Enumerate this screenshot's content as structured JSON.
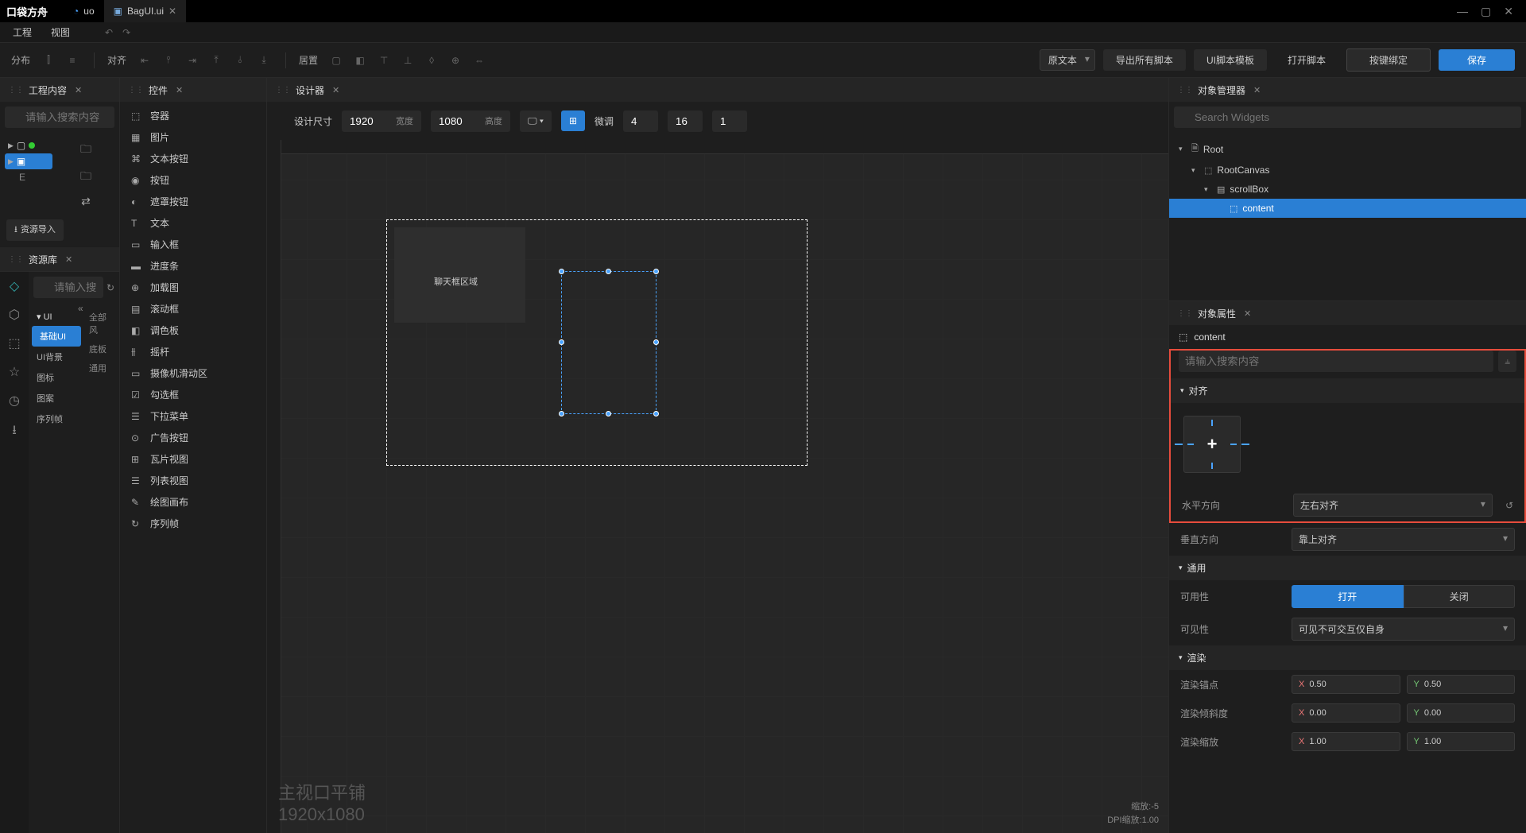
{
  "titlebar": {
    "logo": "口袋方舟",
    "tabs": [
      {
        "icon": "uo-icon",
        "label": "uo"
      },
      {
        "icon": "ui-icon",
        "label": "BagUI.ui"
      }
    ]
  },
  "menubar": {
    "items": [
      "工程",
      "视图"
    ]
  },
  "toolbar": {
    "distribute_label": "分布",
    "align_label": "对齐",
    "center_label": "居置",
    "source_dropdown": "原文本",
    "export_scripts": "导出所有脚本",
    "ui_script_template": "UI脚本模板",
    "open_script": "打开脚本",
    "key_binding": "按键绑定",
    "save": "保存"
  },
  "panels": {
    "project_content": "工程内容",
    "widgets": "控件",
    "designer": "设计器",
    "object_manager": "对象管理器",
    "object_props": "对象属性",
    "resource_lib": "资源库",
    "resource_import": "资源导入"
  },
  "search": {
    "project_placeholder": "请输入搜索内容",
    "resource_placeholder": "请输入搜",
    "widgets_placeholder": "Search Widgets",
    "props_placeholder": "请输入搜索内容"
  },
  "widgets": [
    {
      "icon": "⬚",
      "label": "容器"
    },
    {
      "icon": "▦",
      "label": "图片"
    },
    {
      "icon": "⌘",
      "label": "文本按钮"
    },
    {
      "icon": "◉",
      "label": "按钮"
    },
    {
      "icon": "◐",
      "label": "遮罩按钮"
    },
    {
      "icon": "T",
      "label": "文本"
    },
    {
      "icon": "▭",
      "label": "输入框"
    },
    {
      "icon": "▬",
      "label": "进度条"
    },
    {
      "icon": "⊕",
      "label": "加载图"
    },
    {
      "icon": "▤",
      "label": "滚动框"
    },
    {
      "icon": "◧",
      "label": "调色板"
    },
    {
      "icon": "⫵",
      "label": "摇杆"
    },
    {
      "icon": "▭",
      "label": "摄像机滑动区"
    },
    {
      "icon": "☑",
      "label": "勾选框"
    },
    {
      "icon": "☰",
      "label": "下拉菜单"
    },
    {
      "icon": "⊙",
      "label": "广告按钮"
    },
    {
      "icon": "⊞",
      "label": "瓦片视图"
    },
    {
      "icon": "☰",
      "label": "列表视图"
    },
    {
      "icon": "✎",
      "label": "绘图画布"
    },
    {
      "icon": "↻",
      "label": "序列帧"
    }
  ],
  "resource_categories": {
    "ui": "UI",
    "items": [
      "基础UI",
      "UI背景",
      "图标",
      "图案",
      "序列帧"
    ],
    "filters": [
      "全部风",
      "底板",
      "通用"
    ]
  },
  "design_toolbar": {
    "size_label": "设计尺寸",
    "width": "1920",
    "width_label": "宽度",
    "height": "1080",
    "height_label": "高度",
    "finetune_label": "微调",
    "val1": "4",
    "val2": "16",
    "val3": "1"
  },
  "canvas": {
    "chat_label": "聊天框区域",
    "viewport_label": "主视口平铺",
    "viewport_size": "1920x1080",
    "zoom": "缩放:-5",
    "dpi": "DPI缩放:1.00"
  },
  "object_tree": {
    "root": "Root",
    "canvas": "RootCanvas",
    "scrollbox": "scrollBox",
    "content": "content"
  },
  "props": {
    "name": "content",
    "sections": {
      "align": "对齐",
      "general": "通用",
      "render": "渲染"
    },
    "horizontal_label": "水平方向",
    "horizontal_value": "左右对齐",
    "vertical_label": "垂直方向",
    "vertical_value": "靠上对齐",
    "availability_label": "可用性",
    "open": "打开",
    "close": "关闭",
    "visibility_label": "可见性",
    "visibility_value": "可见不可交互仅自身",
    "render_anchor": "渲染锚点",
    "render_skew": "渲染倾斜度",
    "render_scale": "渲染缩放",
    "anchor_x": "0.50",
    "anchor_y": "0.50",
    "skew_x": "0.00",
    "skew_y": "0.00",
    "scale_x": "1.00",
    "scale_y": "1.00"
  }
}
